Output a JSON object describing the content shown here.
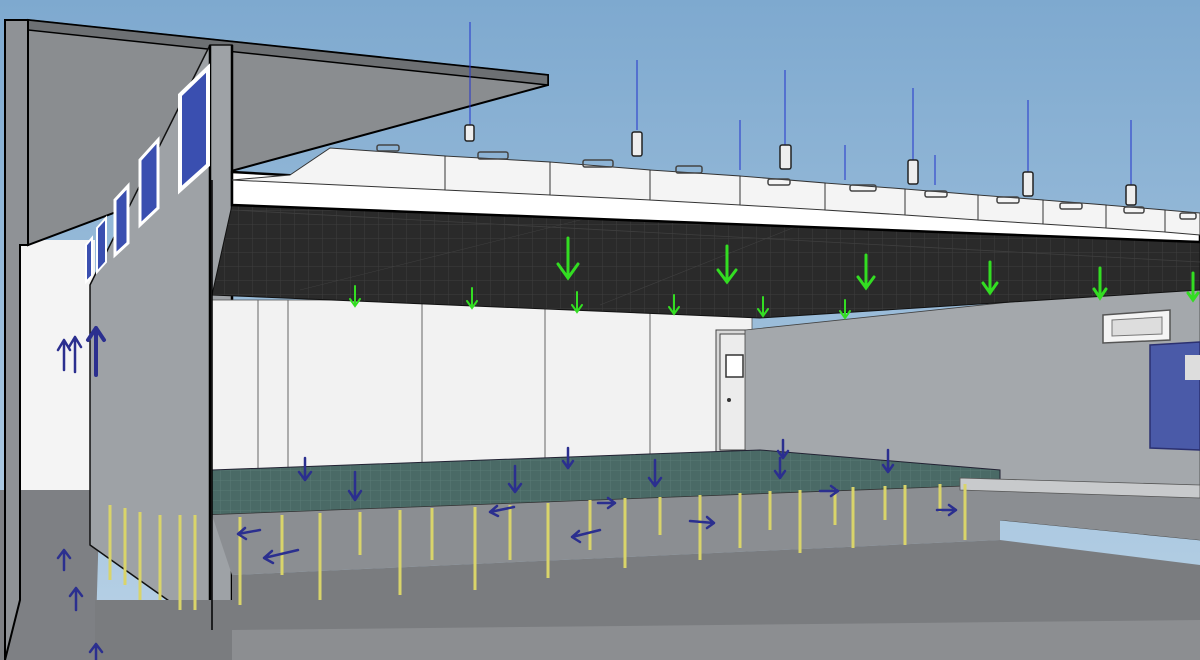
{
  "scene": {
    "colors": {
      "sky_top": "#7ea9cf",
      "sky_bottom": "#b9d2e6",
      "canopy_dark": "#2a2a2a",
      "wall_gray": "#8f9296",
      "wall_light": "#f2f2f2",
      "raised_floor": "#4a6a66",
      "pedestal_yellow": "#d9d46a",
      "floor_gray": "#7a7c7f",
      "supply_arrow": "#33dd22",
      "return_arrow": "#2b2f8f",
      "window_blue": "#3a4fb0",
      "ffu_white": "#f4f4f4"
    }
  }
}
